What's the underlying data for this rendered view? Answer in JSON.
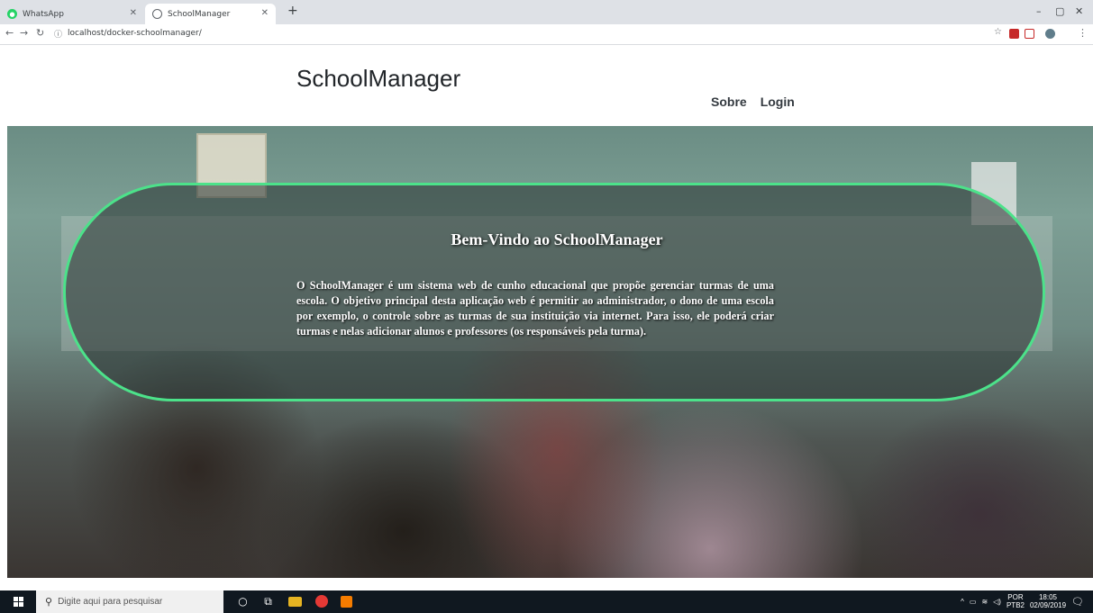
{
  "browser": {
    "tabs": [
      {
        "title": "WhatsApp",
        "icon": "whatsapp-icon"
      },
      {
        "title": "SchoolManager",
        "icon": "globe-icon"
      }
    ],
    "new_tab": "+",
    "url": "localhost/docker-schoolmanager/",
    "win_min": "–",
    "win_max": "▢",
    "win_close": "✕"
  },
  "site": {
    "title": "SchoolManager",
    "nav": {
      "about": "Sobre",
      "login": "Login"
    },
    "accent": "#4ce28a"
  },
  "hero": {
    "heading": "Bem-Vindo ao SchoolManager",
    "text": "O SchoolManager é um sistema web de cunho educacional que propõe gerenciar turmas de uma escola. O objetivo principal desta aplicação web é permitir ao administrador, o dono de uma escola por exemplo, o controle sobre as turmas de sua instituição via internet. Para isso, ele poderá criar turmas e nelas adicionar alunos e professores (os responsáveis pela turma)."
  },
  "taskbar": {
    "search_placeholder": "Digite aqui para pesquisar",
    "lang": "POR",
    "layout": "PTB2",
    "time": "18:05",
    "date": "02/09/2019"
  }
}
